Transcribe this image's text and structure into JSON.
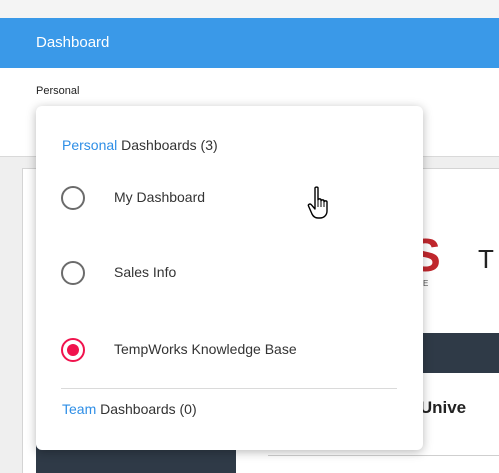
{
  "header": {
    "title": "Dashboard",
    "current_selection": "Personal"
  },
  "background": {
    "title_fragment": "T",
    "logo_fragment": "S",
    "logo_sub": "E",
    "section_fragment": "‹s Unive"
  },
  "dropdown": {
    "personal_section": {
      "accent": "Personal",
      "rest": " Dashboards (3)"
    },
    "options": [
      {
        "label": "My Dashboard",
        "selected": false
      },
      {
        "label": "Sales Info",
        "selected": false
      },
      {
        "label": "TempWorks Knowledge Base",
        "selected": true
      }
    ],
    "team_section": {
      "accent": "Team",
      "rest": " Dashboards (0)"
    }
  },
  "colors": {
    "titlebar": "#3a99e8",
    "accent_text": "#2e8ee6",
    "radio_selected": "#f0134d"
  },
  "icons": {
    "pointer": "hand-pointer-icon"
  }
}
